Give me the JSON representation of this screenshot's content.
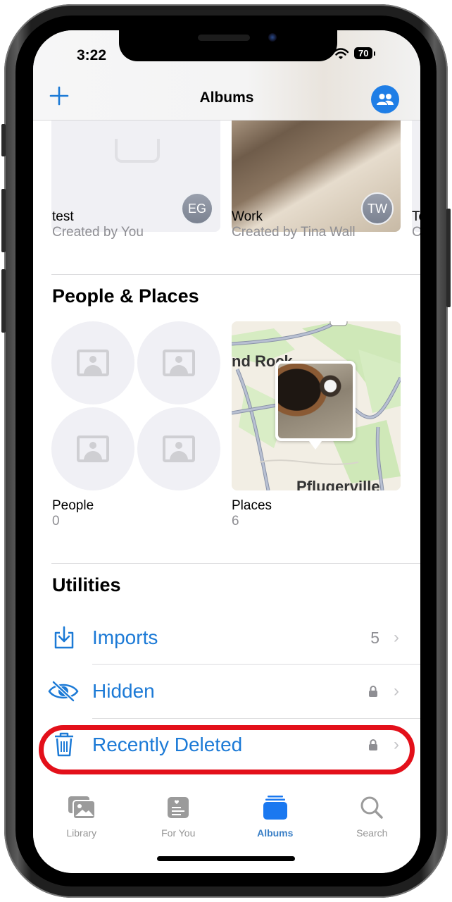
{
  "status_bar": {
    "time": "3:22",
    "battery": "70"
  },
  "nav": {
    "title": "Albums",
    "add_icon": "plus-icon",
    "shared_icon": "people-icon"
  },
  "shared_albums": [
    {
      "name": "test",
      "subtitle": "Created by You",
      "owner_initials": "EG"
    },
    {
      "name": "Work",
      "subtitle": "Created by Tina Wall",
      "owner_initials": "TW"
    },
    {
      "name": "To",
      "subtitle": "C"
    }
  ],
  "people_places": {
    "title": "People & Places",
    "people": {
      "label": "People",
      "count": "0"
    },
    "places": {
      "label": "Places",
      "count": "6",
      "map_labels": [
        "nd Rock",
        "Pflugerville"
      ]
    }
  },
  "utilities": {
    "title": "Utilities",
    "items": [
      {
        "label": "Imports",
        "icon": "import-icon",
        "count": "5",
        "locked": false
      },
      {
        "label": "Hidden",
        "icon": "eye-slash-icon",
        "count": "",
        "locked": true
      },
      {
        "label": "Recently Deleted",
        "icon": "trash-icon",
        "count": "",
        "locked": true,
        "highlighted": true
      }
    ]
  },
  "tab_bar": {
    "tabs": [
      {
        "label": "Library",
        "icon": "photo-library-icon",
        "active": false
      },
      {
        "label": "For You",
        "icon": "for-you-icon",
        "active": false
      },
      {
        "label": "Albums",
        "icon": "albums-icon",
        "active": true
      },
      {
        "label": "Search",
        "icon": "search-icon",
        "active": false
      }
    ]
  },
  "colors": {
    "accent": "#1c7ad6",
    "highlight": "#e3101a",
    "secondary_text": "#8e8e93"
  }
}
